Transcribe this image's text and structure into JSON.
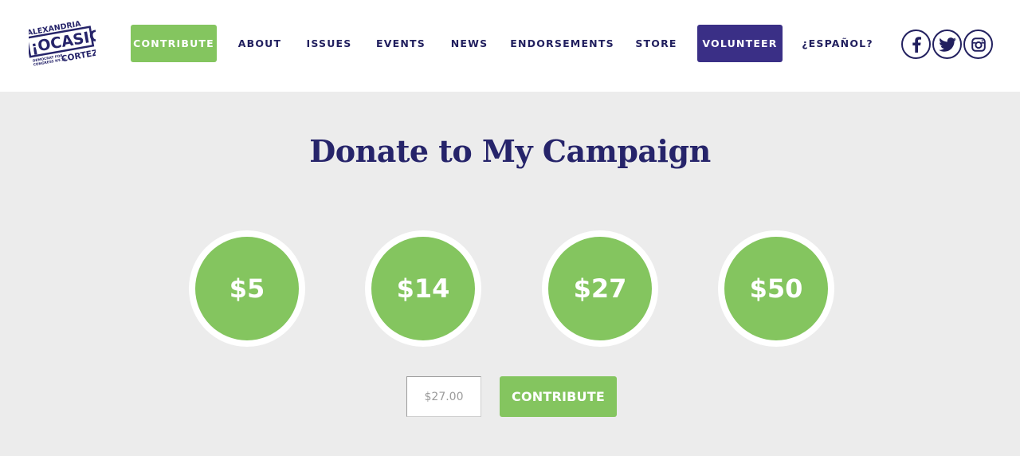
{
  "logo": {
    "top_line": "ALEXANDRIA",
    "main_word": "¡OCASIO!",
    "sub_line_1": "DEMOCRAT FOR",
    "sub_line_2": "CONGRESS NY-14",
    "bottom_word": "CORTEZ"
  },
  "nav": {
    "items": [
      {
        "label": "CONTRIBUTE"
      },
      {
        "label": "ABOUT"
      },
      {
        "label": "ISSUES"
      },
      {
        "label": "EVENTS"
      },
      {
        "label": "NEWS"
      },
      {
        "label": "ENDORSEMENTS"
      },
      {
        "label": "STORE"
      },
      {
        "label": "VOLUNTEER"
      },
      {
        "label": "¿ESPAÑOL?"
      }
    ]
  },
  "social": {
    "icons": [
      "facebook-icon",
      "twitter-icon",
      "instagram-icon"
    ]
  },
  "donate": {
    "title": "Donate to My Campaign",
    "amounts": [
      {
        "label": "$5"
      },
      {
        "label": "$14"
      },
      {
        "label": "$27"
      },
      {
        "label": "$50"
      }
    ],
    "input_placeholder": "$27.00",
    "input_value": "",
    "submit_label": "CONTRIBUTE"
  },
  "colors": {
    "brand_navy": "#22205f",
    "volunteer_purple": "#3a2f86",
    "accent_green": "#84c55f",
    "background_gray": "#ececec"
  }
}
